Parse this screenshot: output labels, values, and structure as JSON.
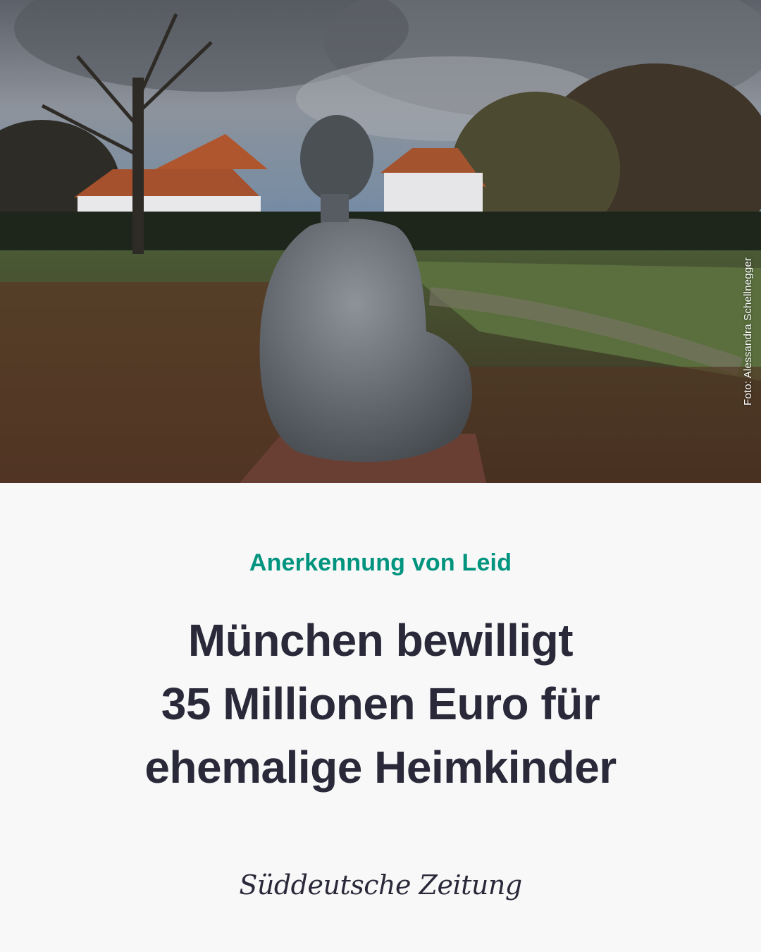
{
  "photo": {
    "credit": "Foto: Alessandra Schellnegger"
  },
  "article": {
    "kicker": "Anerkennung von Leid",
    "headline_lines": [
      "München bewilligt",
      "35 Millionen Euro für",
      "ehemalige Heimkinder"
    ]
  },
  "brand": {
    "name": "Süddeutsche Zeitung"
  },
  "colors": {
    "kicker": "#00947f",
    "headline": "#29293a",
    "background": "#f8f8f8"
  }
}
